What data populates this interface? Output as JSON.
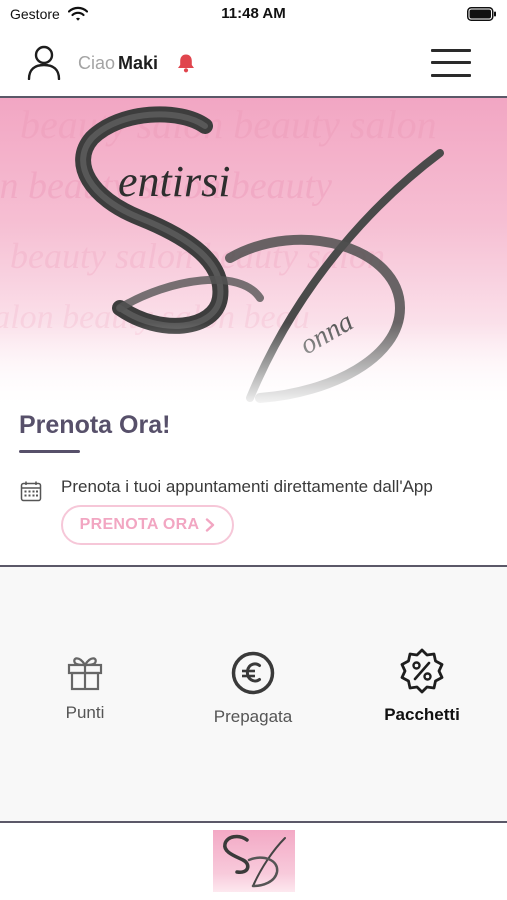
{
  "status_bar": {
    "carrier": "Gestore",
    "time": "11:48 AM"
  },
  "header": {
    "greeting": "Ciao",
    "user_name": "Maki",
    "icons": [
      "user-icon",
      "bell-icon",
      "menu-icon"
    ]
  },
  "hero": {
    "logo_script": "entirsi",
    "logo_sub": "onna"
  },
  "booking": {
    "title": "Prenota Ora!",
    "description": "Prenota i tuoi appuntamenti direttamente dall'App",
    "button_label": "PRENOTA ORA",
    "icon": "calendar-icon"
  },
  "features": [
    {
      "label": "Punti",
      "icon": "gift-icon"
    },
    {
      "label": "Prepagata",
      "icon": "euro-icon"
    },
    {
      "label": "Pacchetti",
      "icon": "discount-badge-icon"
    }
  ],
  "colors": {
    "accent_purple": "#57506a",
    "accent_pink": "#f2a6c2",
    "bell_red": "#e0454d",
    "divider": "#5b5868"
  }
}
